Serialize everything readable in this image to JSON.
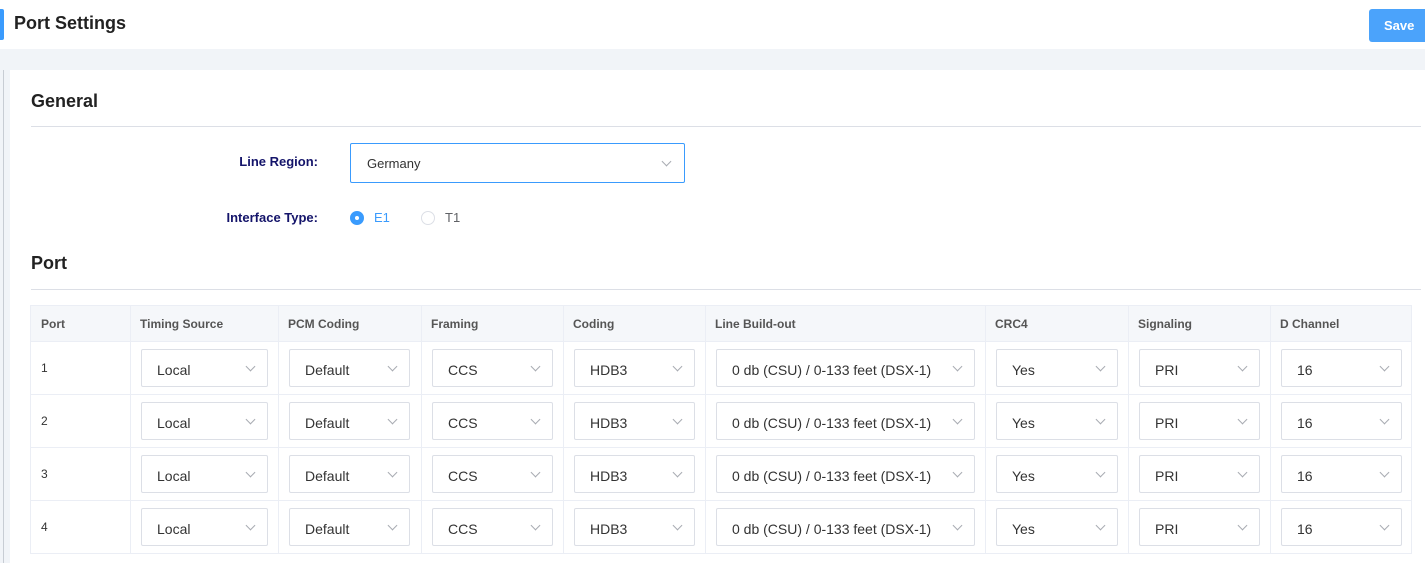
{
  "header": {
    "title": "Port Settings",
    "save_label": "Save"
  },
  "general": {
    "title": "General",
    "line_region_label": "Line Region:",
    "line_region_value": "Germany",
    "interface_type_label": "Interface Type:",
    "interface_options": [
      "E1",
      "T1"
    ],
    "interface_selected": "E1"
  },
  "port_section": {
    "title": "Port",
    "columns": [
      "Port",
      "Timing Source",
      "PCM Coding",
      "Framing",
      "Coding",
      "Line Build-out",
      "CRC4",
      "Signaling",
      "D Channel"
    ],
    "rows": [
      {
        "port": "1",
        "timing": "Local",
        "pcm": "Default",
        "framing": "CCS",
        "coding": "HDB3",
        "lbo": "0 db (CSU) / 0-133 feet (DSX-1)",
        "crc4": "Yes",
        "signaling": "PRI",
        "dchannel": "16"
      },
      {
        "port": "2",
        "timing": "Local",
        "pcm": "Default",
        "framing": "CCS",
        "coding": "HDB3",
        "lbo": "0 db (CSU) / 0-133 feet (DSX-1)",
        "crc4": "Yes",
        "signaling": "PRI",
        "dchannel": "16"
      },
      {
        "port": "3",
        "timing": "Local",
        "pcm": "Default",
        "framing": "CCS",
        "coding": "HDB3",
        "lbo": "0 db (CSU) / 0-133 feet (DSX-1)",
        "crc4": "Yes",
        "signaling": "PRI",
        "dchannel": "16"
      },
      {
        "port": "4",
        "timing": "Local",
        "pcm": "Default",
        "framing": "CCS",
        "coding": "HDB3",
        "lbo": "0 db (CSU) / 0-133 feet (DSX-1)",
        "crc4": "Yes",
        "signaling": "PRI",
        "dchannel": "16"
      }
    ]
  },
  "colors": {
    "accent": "#3a9bfd",
    "label": "#14146a",
    "border": "#dcdfe6",
    "header_bg": "#f5f7fa"
  },
  "icons": {
    "dropdown": "chevron-down-icon",
    "radio_on": "radio-checked-icon",
    "radio_off": "radio-unchecked-icon"
  }
}
